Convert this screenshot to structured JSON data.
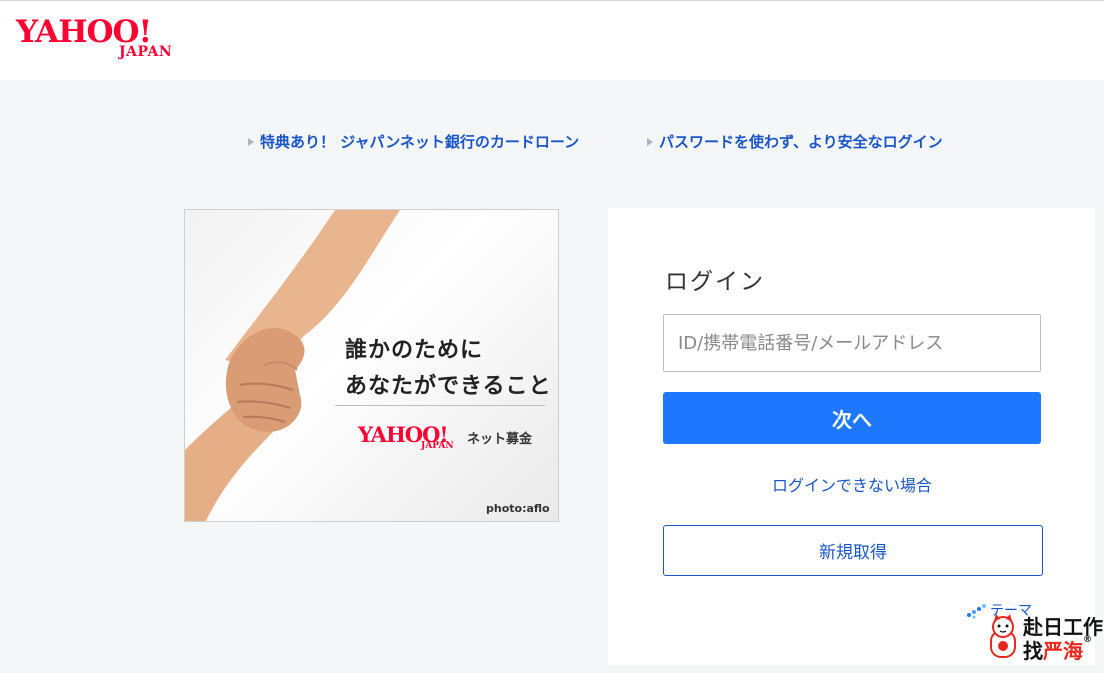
{
  "header": {
    "logo_main": "YAHOO!",
    "logo_sub": "JAPAN"
  },
  "promo_links": [
    {
      "label": "特典あり！ ジャパンネット銀行のカードローン"
    },
    {
      "label": "パスワードを使わず、より安全なログイン"
    }
  ],
  "ad": {
    "line1": "誰かのために",
    "line2": "あなたができること",
    "logo_main": "YAHOO!",
    "logo_sub": "JAPAN",
    "fund": "ネット募金",
    "credit": "photo:aflo"
  },
  "login": {
    "title": "ログイン",
    "id_placeholder": "ID/携帯電話番号/メールアドレス",
    "id_value": "",
    "next_label": "次へ",
    "cant_login_label": "ログインできない場合",
    "signup_label": "新規取得",
    "theme_label": "テーマ"
  },
  "watermark": {
    "line1": "赴日工作",
    "line2_prefix": "找",
    "line2_red": "严海",
    "registered": "®"
  },
  "colors": {
    "brand_red": "#ff0033",
    "link_blue": "#1a56c8",
    "button_blue": "#1e78ff",
    "page_bg": "#f5f6f8"
  }
}
